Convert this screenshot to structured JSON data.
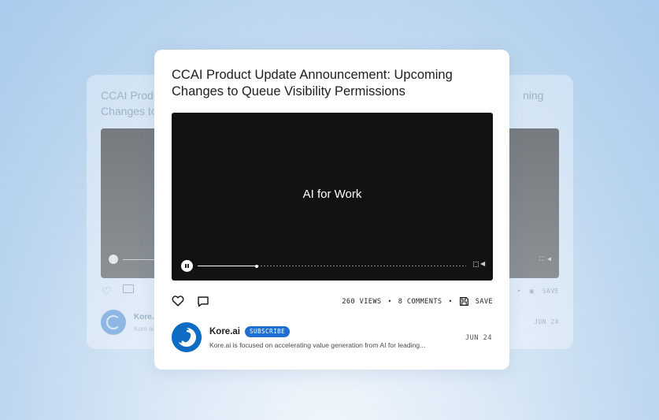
{
  "background_card": {
    "title_line1": "CCAI Produ",
    "title_line2": "Changes to",
    "title_tail": "ning",
    "channel_short": "Kore.ai",
    "desc_short": "Kore.ai i",
    "stats_short": "S",
    "save_label": "SAVE",
    "date": "JUN 24",
    "video_controls": "⛶ ◀"
  },
  "video_card": {
    "title": "CCAI Product Update Announcement: Upcoming Changes to Queue Visibility Permissions",
    "video": {
      "overlay_text": "AI for Work",
      "progress_fraction": 0.22,
      "volume_icon": "◀"
    },
    "actions": {
      "like_icon": "heart-icon",
      "comment_icon": "comment-icon",
      "views": "260 VIEWS",
      "separator": "•",
      "comments": "8 COMMENTS",
      "save_icon": "save-icon",
      "save_label": "SAVE"
    },
    "channel": {
      "name": "Kore.ai",
      "subscribe_label": "SUBSCRIBE",
      "description": "Kore.ai is focused on accelerating value generation from AI for leading...",
      "date": "JUN 24"
    }
  },
  "colors": {
    "accent": "#1e6fd1",
    "video_bg": "#121212",
    "avatar_bg": "#0f6cc4"
  }
}
